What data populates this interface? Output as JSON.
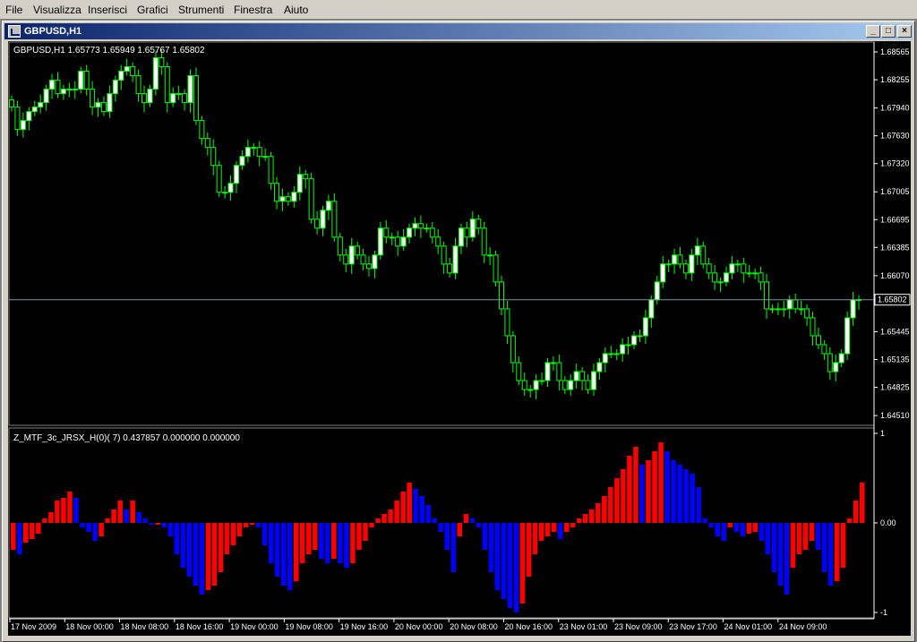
{
  "menu": {
    "items": [
      "File",
      "Visualizza",
      "Inserisci",
      "Grafici",
      "Strumenti",
      "Finestra",
      "Aiuto"
    ]
  },
  "window": {
    "title": "GBPUSD,H1",
    "min_label": "_",
    "max_label": "□",
    "close_label": "×"
  },
  "colors": {
    "background": "#000000",
    "candle_bull_fill": "#ffffff",
    "candle_bear_fill": "#000000",
    "candle_outline": "#00ff00",
    "hist_red": "#ff0000",
    "hist_blue": "#0000ff",
    "axis_text": "#ffffff",
    "price_line": "#7a9aa0"
  },
  "chart_data": [
    {
      "type": "candlestick",
      "title": "GBPUSD,H1",
      "ohlc_label": "1.65773 1.65949 1.65767 1.65802",
      "current_price": 1.65802,
      "current_price_label": "1.65802",
      "ylim": [
        1.64451,
        1.68565
      ],
      "yticks": [
        "1.68565",
        "1.68255",
        "1.67940",
        "1.67630",
        "1.67320",
        "1.67005",
        "1.66695",
        "1.66385",
        "1.66070",
        "1.65445",
        "1.65135",
        "1.64825",
        "1.64510"
      ],
      "close": [
        1.6795,
        1.677,
        1.678,
        1.679,
        1.6795,
        1.68,
        1.6815,
        1.6825,
        1.681,
        1.6815,
        1.6815,
        1.6815,
        1.6835,
        1.6815,
        1.6795,
        1.68,
        1.679,
        1.681,
        1.6825,
        1.6835,
        1.684,
        1.683,
        1.681,
        1.68,
        1.6815,
        1.685,
        1.684,
        1.68,
        1.681,
        1.681,
        1.68,
        1.683,
        1.678,
        1.676,
        1.675,
        1.673,
        1.67,
        1.67,
        1.671,
        1.673,
        1.674,
        1.675,
        1.675,
        1.674,
        1.674,
        1.671,
        1.669,
        1.6695,
        1.669,
        1.67,
        1.672,
        1.6715,
        1.667,
        1.666,
        1.668,
        1.669,
        1.665,
        1.663,
        1.662,
        1.664,
        1.663,
        1.662,
        1.6615,
        1.663,
        1.666,
        1.665,
        1.665,
        1.664,
        1.665,
        1.666,
        1.6665,
        1.666,
        1.666,
        1.665,
        1.664,
        1.662,
        1.661,
        1.664,
        1.666,
        1.665,
        1.667,
        1.666,
        1.663,
        1.663,
        1.66,
        1.657,
        1.654,
        1.651,
        1.649,
        1.648,
        1.648,
        1.649,
        1.649,
        1.651,
        1.651,
        1.649,
        1.648,
        1.649,
        1.65,
        1.649,
        1.648,
        1.65,
        1.651,
        1.652,
        1.652,
        1.652,
        1.653,
        1.653,
        1.654,
        1.654,
        1.656,
        1.658,
        1.66,
        1.662,
        1.662,
        1.663,
        1.662,
        1.661,
        1.663,
        1.664,
        1.662,
        1.661,
        1.66,
        1.66,
        1.661,
        1.662,
        1.662,
        1.661,
        1.661,
        1.661,
        1.66,
        1.657,
        1.657,
        1.657,
        1.657,
        1.658,
        1.657,
        1.657,
        1.656,
        1.654,
        1.653,
        1.652,
        1.65,
        1.651,
        1.652,
        1.656,
        1.658,
        1.65802
      ]
    },
    {
      "type": "bar",
      "title": "Z_MTF_3c_JRSX_H(0)( 7)",
      "values_label": "0.437857 0.000000 0.000000",
      "ylim": [
        -1,
        1
      ],
      "yticks": [
        "1",
        "0.00",
        "-1"
      ],
      "xticks": [
        "17 Nov 2009",
        "18 Nov 00:00",
        "18 Nov 08:00",
        "18 Nov 16:00",
        "19 Nov 00:00",
        "19 Nov 08:00",
        "19 Nov 16:00",
        "20 Nov 00:00",
        "20 Nov 08:00",
        "20 Nov 16:00",
        "23 Nov 01:00",
        "23 Nov 09:00",
        "23 Nov 17:00",
        "24 Nov 01:00",
        "24 Nov 09:00"
      ],
      "values": [
        -0.3,
        -0.35,
        -0.22,
        -0.18,
        -0.12,
        0.05,
        0.12,
        0.25,
        0.28,
        0.35,
        0.28,
        -0.05,
        -0.1,
        -0.2,
        -0.15,
        0.05,
        0.15,
        0.25,
        0.15,
        0.25,
        0.12,
        0.05,
        -0.02,
        -0.02,
        -0.05,
        -0.15,
        -0.35,
        -0.5,
        -0.6,
        -0.7,
        -0.8,
        -0.75,
        -0.7,
        -0.55,
        -0.35,
        -0.25,
        -0.15,
        -0.05,
        -0.02,
        -0.05,
        -0.25,
        -0.45,
        -0.6,
        -0.7,
        -0.75,
        -0.65,
        -0.45,
        -0.35,
        -0.3,
        -0.4,
        -0.45,
        -0.4,
        -0.45,
        -0.5,
        -0.45,
        -0.3,
        -0.2,
        -0.05,
        0.05,
        0.1,
        0.15,
        0.25,
        0.35,
        0.45,
        0.38,
        0.3,
        0.2,
        0.05,
        -0.1,
        -0.3,
        -0.55,
        -0.15,
        0.1,
        0.05,
        -0.05,
        -0.3,
        -0.55,
        -0.75,
        -0.85,
        -0.95,
        -1.0,
        -0.9,
        -0.6,
        -0.35,
        -0.2,
        -0.15,
        -0.1,
        -0.18,
        -0.1,
        -0.05,
        0.05,
        0.1,
        0.15,
        0.22,
        0.3,
        0.4,
        0.5,
        0.6,
        0.75,
        0.85,
        0.65,
        0.7,
        0.8,
        0.9,
        0.8,
        0.7,
        0.65,
        0.6,
        0.55,
        0.4,
        0.05,
        -0.05,
        -0.15,
        -0.2,
        -0.05,
        -0.1,
        -0.15,
        -0.12,
        -0.1,
        -0.2,
        -0.35,
        -0.55,
        -0.7,
        -0.8,
        -0.5,
        -0.35,
        -0.3,
        -0.2,
        -0.3,
        -0.55,
        -0.7,
        -0.65,
        -0.5,
        0.05,
        0.25,
        0.45
      ]
    }
  ]
}
